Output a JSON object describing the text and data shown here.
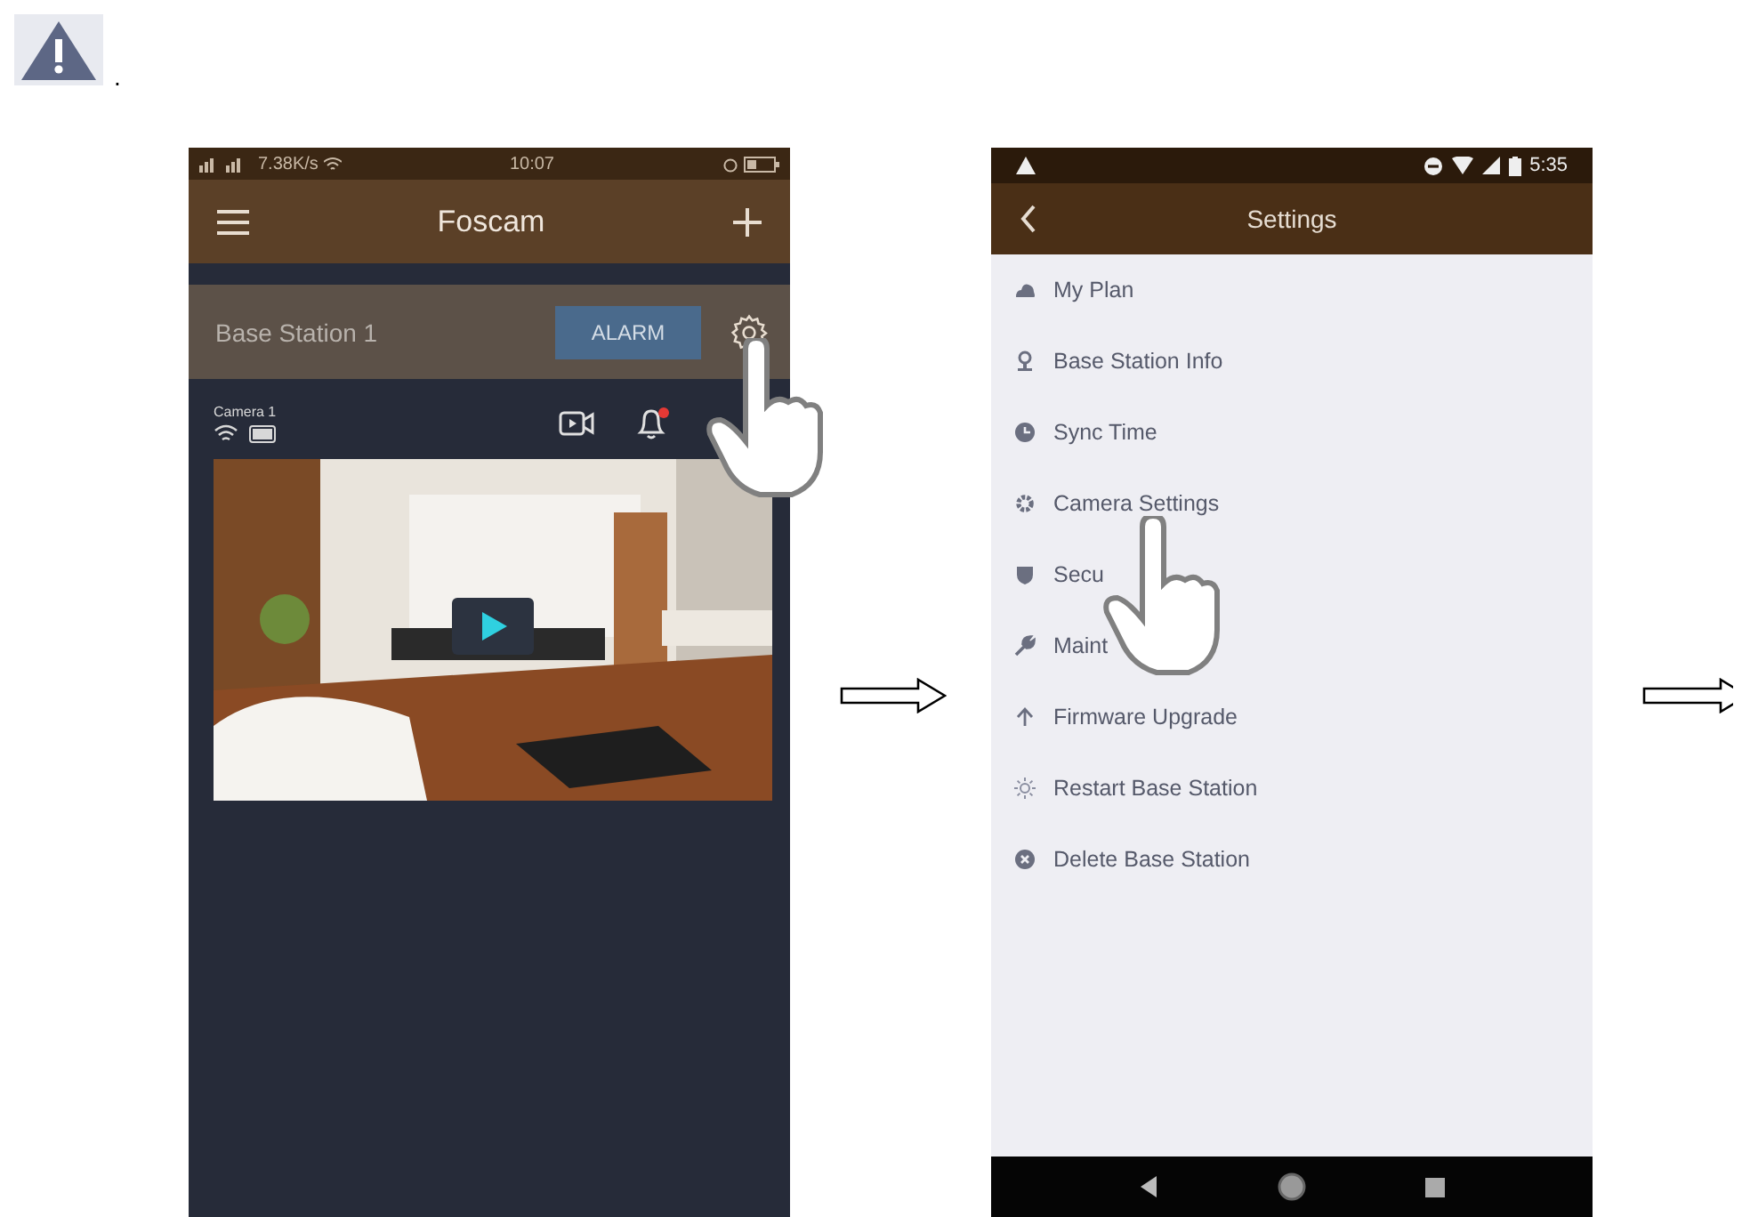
{
  "note": {
    "mark": "."
  },
  "home_screen": {
    "status": {
      "speed": "7.38K/s",
      "time": "10:07"
    },
    "title": "Foscam",
    "base_station": {
      "name": "Base Station 1",
      "button": "ALARM"
    },
    "camera": {
      "name": "Camera 1",
      "unread": true
    }
  },
  "settings_screen": {
    "status": {
      "time": "5:35"
    },
    "title": "Settings",
    "items": [
      {
        "label": "My Plan"
      },
      {
        "label": "Base Station Info"
      },
      {
        "label": "Sync Time"
      },
      {
        "label": "Camera Settings"
      },
      {
        "label": "Secu"
      },
      {
        "label": "Maint"
      },
      {
        "label": "Firmware Upgrade"
      },
      {
        "label": "Restart Base Station"
      },
      {
        "label": "Delete Base Station"
      }
    ]
  }
}
